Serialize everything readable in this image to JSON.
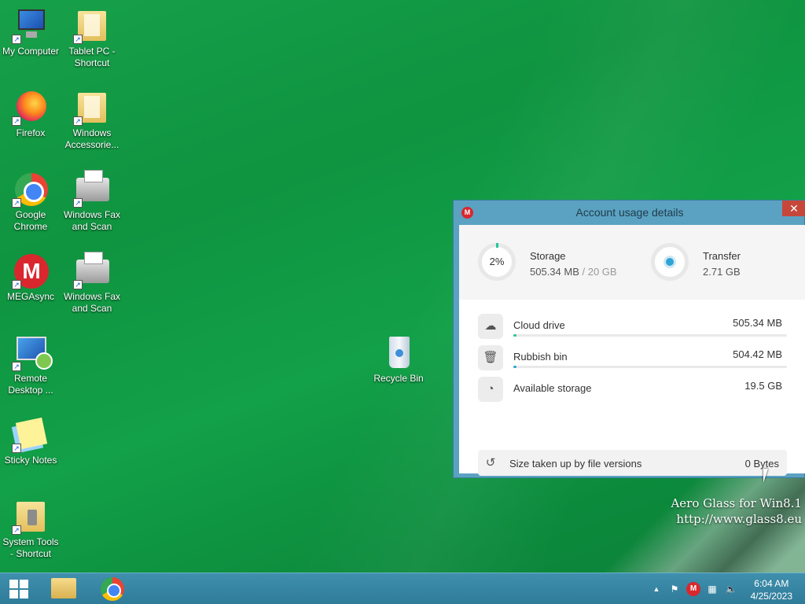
{
  "desktop": {
    "icons": [
      {
        "label": "My Computer"
      },
      {
        "label": "Tablet PC - Shortcut"
      },
      {
        "label": "Firefox"
      },
      {
        "label": "Windows Accessorie..."
      },
      {
        "label": "Google Chrome"
      },
      {
        "label": "Windows Fax and Scan"
      },
      {
        "label": "MEGAsync"
      },
      {
        "label": "Windows Fax and Scan"
      },
      {
        "label": "Remote Desktop ..."
      },
      {
        "label": "Sticky Notes"
      },
      {
        "label": "System Tools - Shortcut"
      },
      {
        "label": "Recycle Bin"
      }
    ],
    "watermark": {
      "line1": "Aero Glass for Win8.1",
      "line2": "http://www.glass8.eu"
    }
  },
  "dialog": {
    "title": "Account usage details",
    "logo": "M",
    "close_label": "✕",
    "storage": {
      "percent": "2%",
      "title": "Storage",
      "used": "505.34 MB",
      "total": "/ 20 GB",
      "fraction": 0.02
    },
    "transfer": {
      "title": "Transfer",
      "value": "2.71 GB"
    },
    "rows": [
      {
        "label": "Cloud drive",
        "value": "505.34 MB",
        "fraction": 0.01,
        "color": "#27c59c"
      },
      {
        "label": "Rubbish bin",
        "value": "504.42 MB",
        "fraction": 0.01,
        "color": "#2fa3d4"
      },
      {
        "label": "Available storage",
        "value": "19.5 GB"
      }
    ],
    "versions": {
      "label": "Size taken up by file versions",
      "value": "0 Bytes"
    }
  },
  "taskbar": {
    "clock": {
      "time": "6:04 AM",
      "date": "4/25/2023"
    },
    "tray": {
      "overflow": "▲",
      "mega": "M"
    }
  },
  "colors": {
    "accent": "#0f9440",
    "mega_red": "#d9272e",
    "dialog_frame": "#5ba2c2",
    "taskbar": "#2f7c99"
  }
}
